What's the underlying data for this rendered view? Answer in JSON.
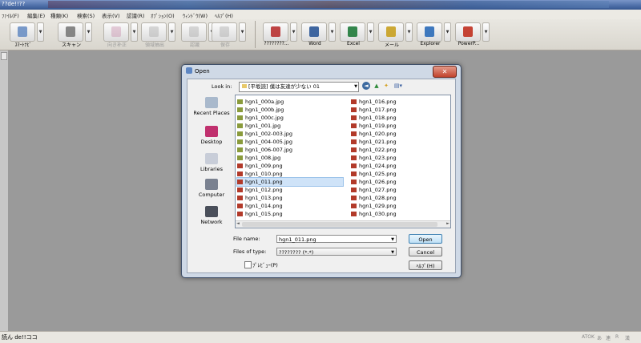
{
  "app": {
    "title": "??de!!??"
  },
  "menu": [
    "ﾌｧｲﾙ(F)",
    "編集(E)",
    "種類(K)",
    "検索(S)",
    "表示(V)",
    "認識(R)",
    "ｵﾌﾟｼｮﾝ(O)",
    "ｳｨﾝﾄﾞｳ(W)",
    "ﾍﾙﾌﾟ(H)"
  ],
  "toolbar": [
    {
      "label": "ｽﾏｰﾄﾅﾋﾞ",
      "icon": "smart-navi-icon",
      "enabled": true
    },
    {
      "label": "スキャン",
      "icon": "scanner-icon",
      "enabled": true
    },
    {
      "label": "向き补正",
      "icon": "rotate-correction-icon",
      "enabled": false
    },
    {
      "label": "領域抽出",
      "icon": "region-extract-icon",
      "enabled": false
    },
    {
      "label": "認識",
      "icon": "recognize-icon",
      "enabled": false
    },
    {
      "label": "保存",
      "icon": "save-icon",
      "enabled": false
    },
    {
      "label": "????????...",
      "icon": "add-document-icon",
      "enabled": true
    },
    {
      "label": "Word",
      "icon": "word-icon",
      "enabled": true
    },
    {
      "label": "Excel",
      "icon": "excel-icon",
      "enabled": true
    },
    {
      "label": "メール",
      "icon": "mail-icon",
      "enabled": true
    },
    {
      "label": "Explorer",
      "icon": "explorer-icon",
      "enabled": true
    },
    {
      "label": "PowerP...",
      "icon": "powerpoint-icon",
      "enabled": true
    }
  ],
  "dialog": {
    "title": "Open",
    "close_glyph": "✕",
    "look_in_label": "Look in:",
    "look_in_value": "[平坂読] 僕は友達が少ない 01",
    "places": [
      {
        "label": "Recent Places",
        "icon": "recent-places-icon"
      },
      {
        "label": "Desktop",
        "icon": "desktop-icon"
      },
      {
        "label": "Libraries",
        "icon": "libraries-icon"
      },
      {
        "label": "Computer",
        "icon": "computer-icon"
      },
      {
        "label": "Network",
        "icon": "network-icon"
      }
    ],
    "files_col1": [
      "hgn1_000a.jpg",
      "hgn1_000b.jpg",
      "hgn1_000c.jpg",
      "hgn1_001.jpg",
      "hgn1_002-003.jpg",
      "hgn1_004-005.jpg",
      "hgn1_006-007.jpg",
      "hgn1_008.jpg",
      "hgn1_009.png",
      "hgn1_010.png",
      "hgn1_011.png",
      "hgn1_012.png",
      "hgn1_013.png",
      "hgn1_014.png",
      "hgn1_015.png"
    ],
    "files_col2": [
      "hgn1_016.png",
      "hgn1_017.png",
      "hgn1_018.png",
      "hgn1_019.png",
      "hgn1_020.png",
      "hgn1_021.png",
      "hgn1_022.png",
      "hgn1_023.png",
      "hgn1_024.png",
      "hgn1_025.png",
      "hgn1_026.png",
      "hgn1_027.png",
      "hgn1_028.png",
      "hgn1_029.png",
      "hgn1_030.png"
    ],
    "selected_file": "hgn1_011.png",
    "file_name_label": "File name:",
    "file_name_value": "hgn1_011.png",
    "file_type_label": "Files of type:",
    "file_type_value": "???????? (*.*)",
    "open_button": "Open",
    "cancel_button": "Cancel",
    "help_button": "ﾍﾙﾌﾟ(H)",
    "preview_label": "ﾌﾟﾚﾋﾞｭｰ(P)"
  },
  "status": {
    "text": "読ん de!!ココ",
    "ime": [
      "ATOK",
      "あ",
      "連",
      "R",
      "漢"
    ]
  }
}
